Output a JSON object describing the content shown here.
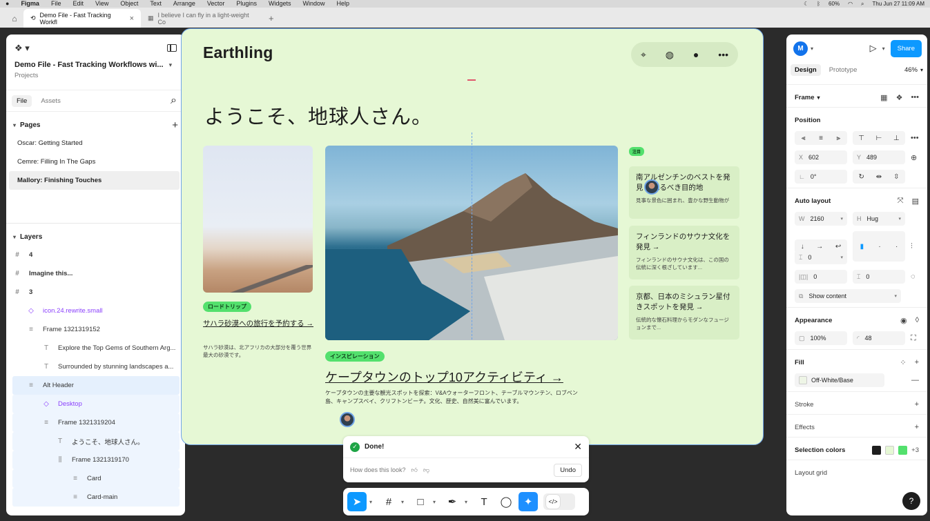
{
  "menubar": {
    "items": [
      "Figma",
      "File",
      "Edit",
      "View",
      "Object",
      "Text",
      "Arrange",
      "Vector",
      "Plugins",
      "Widgets",
      "Window",
      "Help"
    ],
    "battery": "60%",
    "clock": "Thu Jun 27  11:09 AM"
  },
  "tabs": {
    "active_title": "Demo File - Fast Tracking Workfl",
    "inactive_title": "I believe I can fly in a light-weight Co"
  },
  "left_panel": {
    "file_name": "Demo File - Fast Tracking Workflows wi...",
    "projects_label": "Projects",
    "tab_file": "File",
    "tab_assets": "Assets",
    "pages_label": "Pages",
    "pages": [
      "Oscar: Getting Started",
      "Cemre: Filling In The Gaps",
      "Mallory: Finishing Touches"
    ],
    "layers_label": "Layers",
    "layers": [
      {
        "glyph": "#",
        "label": "4"
      },
      {
        "glyph": "#",
        "label": "Imagine this..."
      },
      {
        "glyph": "#",
        "label": "3"
      },
      {
        "glyph": "◇",
        "label": "icon.24.rewrite.small"
      },
      {
        "glyph": "≡",
        "label": "Frame 1321319152"
      },
      {
        "glyph": "T",
        "label": "Explore the Top Gems of Southern Arg..."
      },
      {
        "glyph": "T",
        "label": "Surrounded by stunning landscapes a..."
      },
      {
        "glyph": "≡",
        "label": "Alt Header"
      },
      {
        "glyph": "◇",
        "label": "Desktop"
      },
      {
        "glyph": "≡",
        "label": "Frame 1321319204"
      },
      {
        "glyph": "T",
        "label": "ようこそ、地球人さん。"
      },
      {
        "glyph": "⫼",
        "label": "Frame 1321319170"
      },
      {
        "glyph": "≡",
        "label": "Card"
      },
      {
        "glyph": "≡",
        "label": "Card-main"
      }
    ]
  },
  "canvas": {
    "brand": "Earthling",
    "hero_title": "ようこそ、地球人さん。",
    "left_card": {
      "tag": "ロードトリップ",
      "title": "サハラ砂漠への旅行を予約する →",
      "desc": "サハラ砂漠は、北アフリカの大部分を覆う世界最大の砂漠です。"
    },
    "main_card": {
      "tag": "インスピレーション",
      "title": "ケープタウンのトップ10アクティビティ →",
      "desc": "ケープタウンの主要な観光スポットを探索：V&Aウォーターフロント、テーブルマウンテン、ロブベン島、キャンプスベイ、クリフトンビーチ。文化、歴史、自然美に富んでいます。"
    },
    "side_tag": "注目",
    "side_cards": [
      {
        "title": "南アルゼンチンのベストを発見 訪れるべき目的地",
        "desc": "見事な景色に囲まれ、豊かな野生動物が"
      },
      {
        "title": "フィンランドのサウナ文化を発見 →",
        "desc": "フィンランドのサウナ文化は、この国の伝統に深く根ざしています..."
      },
      {
        "title": "京都、日本のミシュラン星付きスポットを発見 →",
        "desc": "伝統的な懐石料理からモダンなフュージョンまで..."
      }
    ]
  },
  "toast": {
    "title": "Done!",
    "question": "How does this look?",
    "undo": "Undo"
  },
  "right_panel": {
    "avatar_letter": "M",
    "share": "Share",
    "tab_design": "Design",
    "tab_prototype": "Prototype",
    "zoom": "46%",
    "frame_label": "Frame",
    "position_label": "Position",
    "x_label": "X",
    "x_value": "602",
    "y_label": "Y",
    "y_value": "489",
    "rotation": "0°",
    "autolayout_label": "Auto layout",
    "w_label": "W",
    "w_value": "2160",
    "h_label": "H",
    "h_value": "Hug",
    "gap_value": "0",
    "pad_h": "0",
    "pad_v": "0",
    "show_content": "Show content",
    "appearance_label": "Appearance",
    "opacity": "100%",
    "radius": "48",
    "fill_label": "Fill",
    "fill_name": "Off-White/Base",
    "stroke_label": "Stroke",
    "effects_label": "Effects",
    "selection_colors_label": "Selection colors",
    "selection_colors": [
      "#1e1e1e",
      "#e6f8d5",
      "#53e06d"
    ],
    "more_colors": "+3",
    "layout_grid_label": "Layout grid",
    "help": "?"
  },
  "colors": {
    "accent": "#0d99ff",
    "canvas_bg": "#e6f8d5",
    "tag_green": "#53e06d",
    "selection_blue": "#6ea3e8"
  }
}
